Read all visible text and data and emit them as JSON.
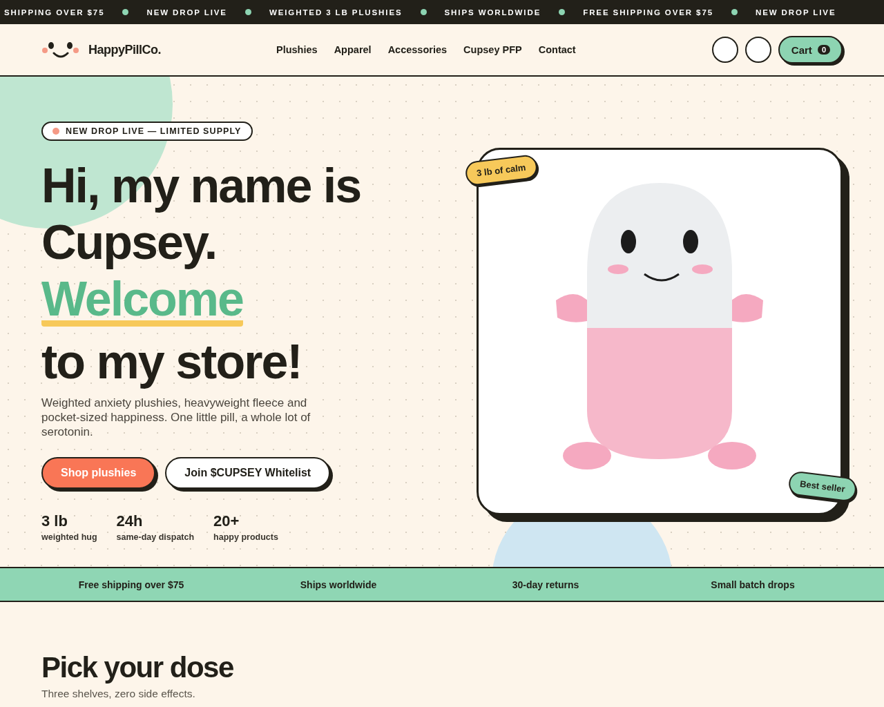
{
  "ticker": [
    "SHIPPING OVER $75",
    "NEW DROP LIVE",
    "WEIGHTED 3 LB PLUSHIES",
    "SHIPS WORLDWIDE",
    "FREE SHIPPING OVER $75",
    "NEW DROP LIVE"
  ],
  "header": {
    "brand": "HappyPillCo.",
    "nav": [
      "Plushies",
      "Apparel",
      "Accessories",
      "Cupsey PFP",
      "Contact"
    ],
    "cart": {
      "label": "Cart",
      "count": "0"
    }
  },
  "hero": {
    "badge": "NEW DROP LIVE — LIMITED SUPPLY",
    "heading": [
      {
        "text": "Hi, my name is",
        "kind": "plain"
      },
      {
        "text": "Cupsey.",
        "kind": "plain"
      },
      {
        "text": "Welcome",
        "kind": "accent"
      },
      {
        "text": "to my store!",
        "kind": "plain"
      }
    ],
    "description": "Weighted anxiety plushies, heavyweight fleece and pocket-sized happiness. One little pill, a whole lot of serotonin.",
    "buttons": [
      {
        "label": "Shop plushies",
        "kind": "primary"
      },
      {
        "label": "Join $CUPSEY Whitelist",
        "kind": "secondary"
      }
    ],
    "stats": [
      {
        "value": "3 lb",
        "label": "weighted hug"
      },
      {
        "value": "24h",
        "label": "same-day dispatch"
      },
      {
        "value": "20+",
        "label": "happy products"
      }
    ],
    "image_tags": [
      {
        "text": "3 lb of calm",
        "kind": "top"
      },
      {
        "text": "Best seller",
        "kind": "bottom"
      }
    ]
  },
  "features": [
    "Free shipping over $75",
    "Ships worldwide",
    "30-day returns",
    "Small batch drops"
  ],
  "section": {
    "title": "Pick your dose",
    "subtitle": "Three shelves, zero side effects."
  }
}
